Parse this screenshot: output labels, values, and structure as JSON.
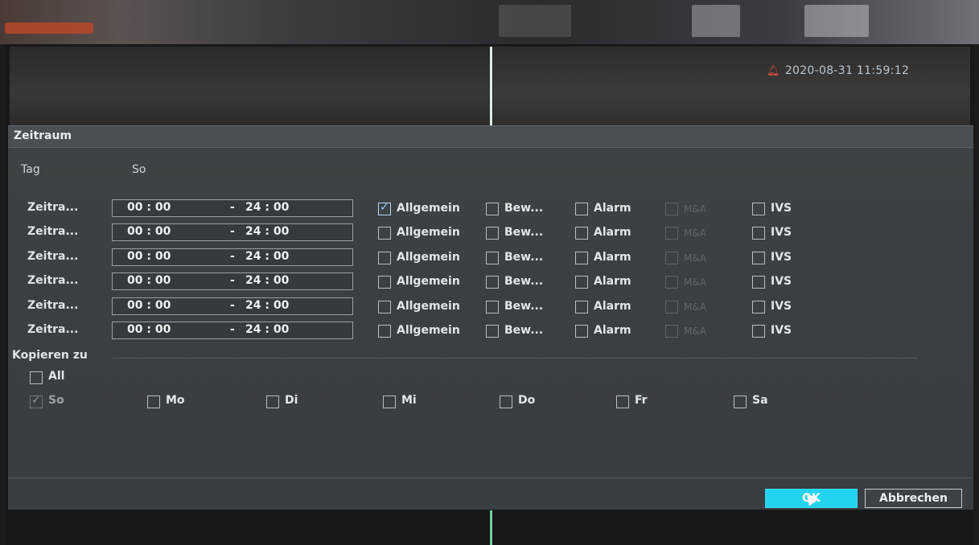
{
  "status": {
    "timestamp": "2020-08-31 11:59:12",
    "bell_color": "#e5533d"
  },
  "dialog": {
    "title": "Zeitraum",
    "day_label": "Tag",
    "day_value": "So",
    "period_rows": [
      {
        "label": "Zeitra...",
        "start": "00 : 00",
        "sep": "-",
        "end": "24 : 00",
        "options": [
          {
            "label": "Allgemein",
            "checked": true,
            "enabled": true
          },
          {
            "label": "Bew...",
            "checked": false,
            "enabled": true
          },
          {
            "label": "Alarm",
            "checked": false,
            "enabled": true
          },
          {
            "label": "M&A",
            "checked": false,
            "enabled": false
          },
          {
            "label": "IVS",
            "checked": false,
            "enabled": true
          }
        ]
      },
      {
        "label": "Zeitra...",
        "start": "00 : 00",
        "sep": "-",
        "end": "24 : 00",
        "options": [
          {
            "label": "Allgemein",
            "checked": false,
            "enabled": true
          },
          {
            "label": "Bew...",
            "checked": false,
            "enabled": true
          },
          {
            "label": "Alarm",
            "checked": false,
            "enabled": true
          },
          {
            "label": "M&A",
            "checked": false,
            "enabled": false
          },
          {
            "label": "IVS",
            "checked": false,
            "enabled": true
          }
        ]
      },
      {
        "label": "Zeitra...",
        "start": "00 : 00",
        "sep": "-",
        "end": "24 : 00",
        "options": [
          {
            "label": "Allgemein",
            "checked": false,
            "enabled": true
          },
          {
            "label": "Bew...",
            "checked": false,
            "enabled": true
          },
          {
            "label": "Alarm",
            "checked": false,
            "enabled": true
          },
          {
            "label": "M&A",
            "checked": false,
            "enabled": false
          },
          {
            "label": "IVS",
            "checked": false,
            "enabled": true
          }
        ]
      },
      {
        "label": "Zeitra...",
        "start": "00 : 00",
        "sep": "-",
        "end": "24 : 00",
        "options": [
          {
            "label": "Allgemein",
            "checked": false,
            "enabled": true
          },
          {
            "label": "Bew...",
            "checked": false,
            "enabled": true
          },
          {
            "label": "Alarm",
            "checked": false,
            "enabled": true
          },
          {
            "label": "M&A",
            "checked": false,
            "enabled": false
          },
          {
            "label": "IVS",
            "checked": false,
            "enabled": true
          }
        ]
      },
      {
        "label": "Zeitra...",
        "start": "00 : 00",
        "sep": "-",
        "end": "24 : 00",
        "options": [
          {
            "label": "Allgemein",
            "checked": false,
            "enabled": true
          },
          {
            "label": "Bew...",
            "checked": false,
            "enabled": true
          },
          {
            "label": "Alarm",
            "checked": false,
            "enabled": true
          },
          {
            "label": "M&A",
            "checked": false,
            "enabled": false
          },
          {
            "label": "IVS",
            "checked": false,
            "enabled": true
          }
        ]
      },
      {
        "label": "Zeitra...",
        "start": "00 : 00",
        "sep": "-",
        "end": "24 : 00",
        "options": [
          {
            "label": "Allgemein",
            "checked": false,
            "enabled": true
          },
          {
            "label": "Bew...",
            "checked": false,
            "enabled": true
          },
          {
            "label": "Alarm",
            "checked": false,
            "enabled": true
          },
          {
            "label": "M&A",
            "checked": false,
            "enabled": false
          },
          {
            "label": "IVS",
            "checked": false,
            "enabled": true
          }
        ]
      }
    ],
    "copy_section": "Kopieren zu",
    "copy_all": {
      "label": "All",
      "checked": false
    },
    "copy_days": [
      {
        "label": "So",
        "checked": true,
        "enabled": false
      },
      {
        "label": "Mo",
        "checked": false,
        "enabled": true
      },
      {
        "label": "Di",
        "checked": false,
        "enabled": true
      },
      {
        "label": "Mi",
        "checked": false,
        "enabled": true
      },
      {
        "label": "Do",
        "checked": false,
        "enabled": true
      },
      {
        "label": "Fr",
        "checked": false,
        "enabled": true
      },
      {
        "label": "Sa",
        "checked": false,
        "enabled": true
      }
    ],
    "ok_label": "OK",
    "cancel_label": "Abbrechen",
    "accent_color": "#22d3ee"
  }
}
